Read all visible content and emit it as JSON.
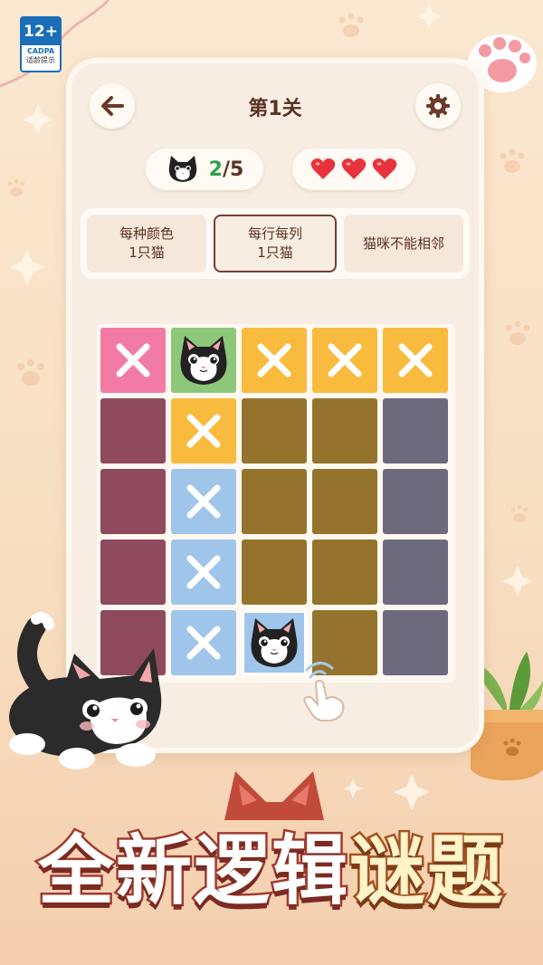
{
  "age_badge": {
    "rating": "12+",
    "org": "CADPA",
    "tip": "适龄提示"
  },
  "header": {
    "title": "第1关"
  },
  "progress": {
    "current": "2",
    "total": "/5"
  },
  "lives": {
    "count": 3
  },
  "rules": [
    {
      "label": "每种颜色\n1只猫",
      "active": false
    },
    {
      "label": "每行每列\n1只猫",
      "active": true
    },
    {
      "label": "猫咪不能相邻",
      "active": false
    }
  ],
  "colors": {
    "pink": "#f27ba6",
    "green": "#8dc87a",
    "yellow": "#f8bb3d",
    "plum": "#8f4a5e",
    "olive": "#94742d",
    "slate": "#6d6a7e",
    "blue": "#9fc6ea"
  },
  "board": [
    [
      {
        "color": "pink",
        "mark": "x"
      },
      {
        "color": "green",
        "mark": "cat"
      },
      {
        "color": "yellow",
        "mark": "x"
      },
      {
        "color": "yellow",
        "mark": "x"
      },
      {
        "color": "yellow",
        "mark": "x"
      }
    ],
    [
      {
        "color": "plum",
        "mark": ""
      },
      {
        "color": "yellow",
        "mark": "x"
      },
      {
        "color": "olive",
        "mark": ""
      },
      {
        "color": "olive",
        "mark": ""
      },
      {
        "color": "slate",
        "mark": ""
      }
    ],
    [
      {
        "color": "plum",
        "mark": ""
      },
      {
        "color": "blue",
        "mark": "x"
      },
      {
        "color": "olive",
        "mark": ""
      },
      {
        "color": "olive",
        "mark": ""
      },
      {
        "color": "slate",
        "mark": ""
      }
    ],
    [
      {
        "color": "plum",
        "mark": ""
      },
      {
        "color": "blue",
        "mark": "x"
      },
      {
        "color": "olive",
        "mark": ""
      },
      {
        "color": "olive",
        "mark": ""
      },
      {
        "color": "slate",
        "mark": ""
      }
    ],
    [
      {
        "color": "plum",
        "mark": ""
      },
      {
        "color": "blue",
        "mark": "x"
      },
      {
        "color": "blue",
        "mark": "cat"
      },
      {
        "color": "olive",
        "mark": ""
      },
      {
        "color": "slate",
        "mark": ""
      }
    ]
  ],
  "banner": {
    "part1": "全新逻辑",
    "part2": "谜题"
  }
}
